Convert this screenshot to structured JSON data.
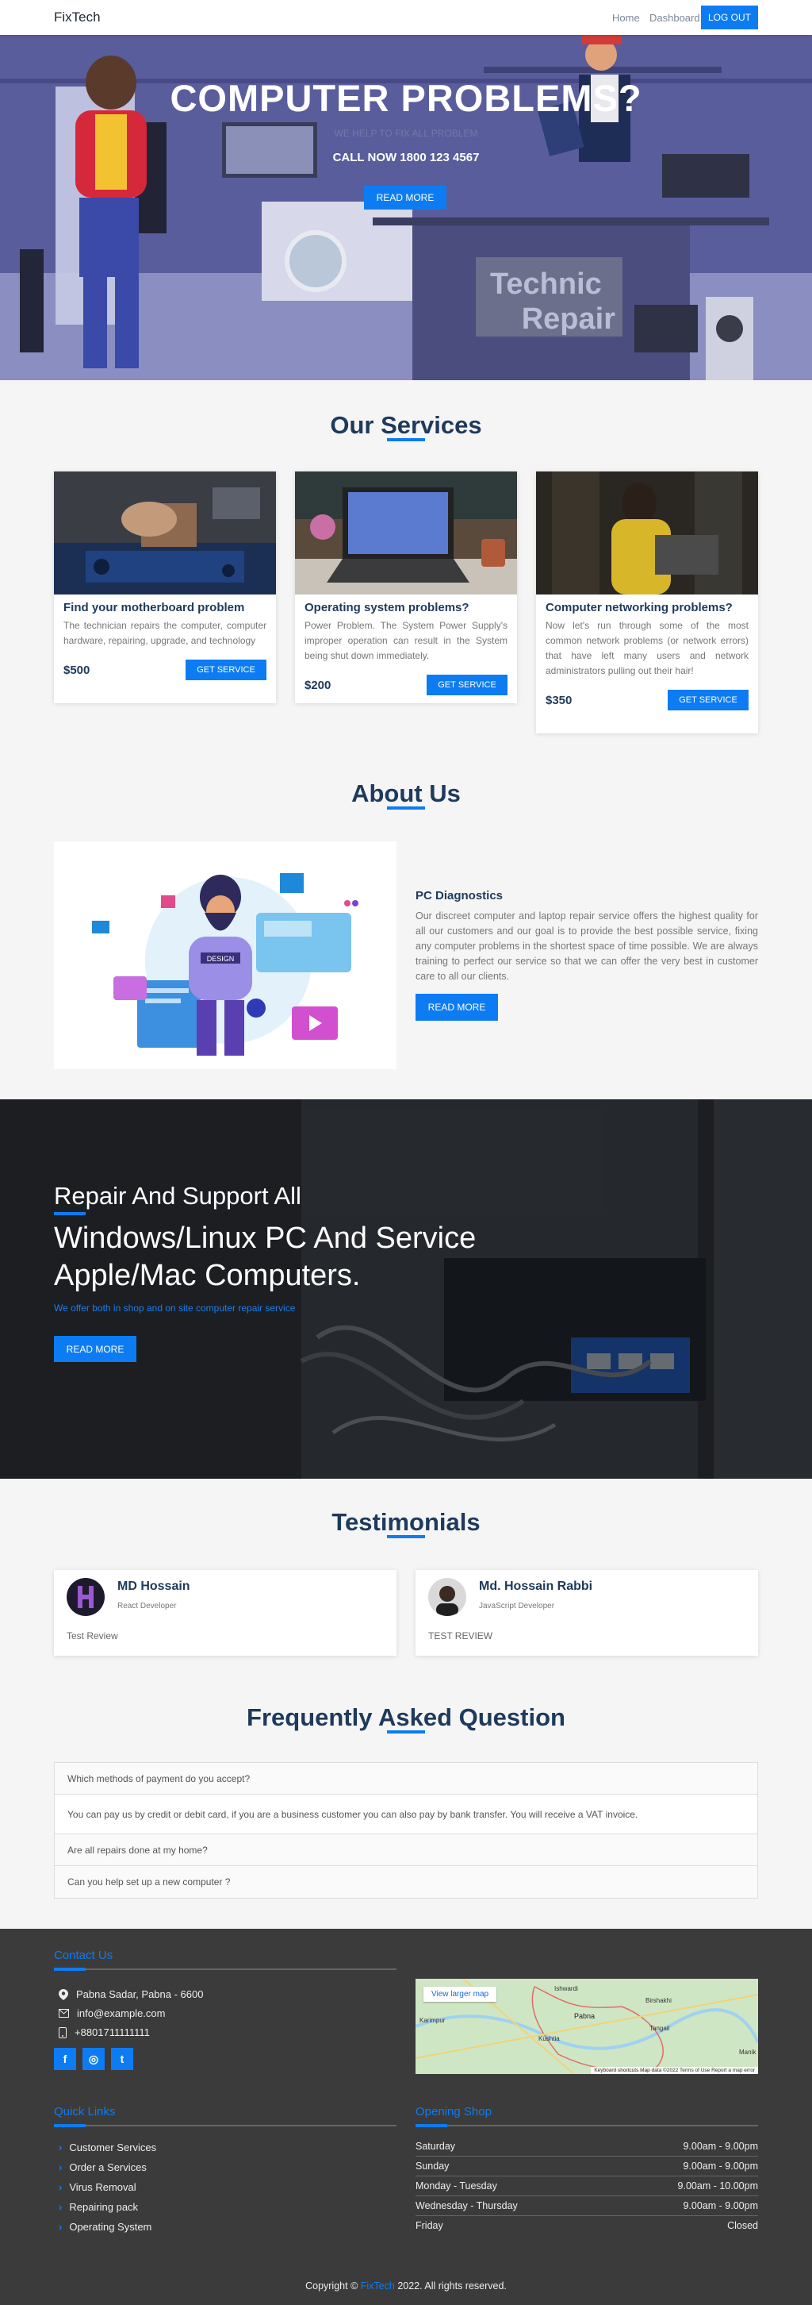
{
  "nav": {
    "brand": "FixTech",
    "home": "Home",
    "dashboard": "Dashboard",
    "logout": "LOG OUT"
  },
  "hero": {
    "title": "COMPUTER PROBLEMS?",
    "subtitle": "WE HELP TO FIX ALL PROBLEM",
    "call": "CALL NOW 1800 123 4567",
    "button": "READ MORE",
    "sign": [
      "Technic",
      "Repair"
    ]
  },
  "services": {
    "title": "Our Services",
    "cards": [
      {
        "title": "Find your motherboard problem",
        "text": "The technician repairs the computer, computer hardware, repairing, upgrade, and technology",
        "price": "$500",
        "button": "GET SERVICE"
      },
      {
        "title": "Operating system problems?",
        "text": "Power Problem. The System Power Supply's improper operation can result in the System being shut down immediately.",
        "price": "$200",
        "button": "GET SERVICE"
      },
      {
        "title": "Computer networking problems?",
        "text": "Now let's run through some of the most common network problems (or network errors) that have left many users and network administrators pulling out their hair!",
        "price": "$350",
        "button": "GET SERVICE"
      }
    ]
  },
  "about": {
    "title": "About Us",
    "heading": "PC Diagnostics",
    "text": "Our discreet computer and laptop repair service offers the highest quality for all our customers and our goal is to provide the best possible service, fixing any computer problems in the shortest space of time possible. We are always training to perfect our service so that we can offer the very best in customer care to all our clients.",
    "button": "READ MORE",
    "illustration_label": "DESIGN"
  },
  "banner": {
    "line1": "Repair And Support All",
    "line2": "Windows/Linux PC And Service",
    "line3": "Apple/Mac Computers.",
    "text": "We offer both in shop and on site computer repair service",
    "button": "READ MORE"
  },
  "testimonials": {
    "title": "Testimonials",
    "items": [
      {
        "name": "MD Hossain",
        "role": "React Developer",
        "review": "Test Review"
      },
      {
        "name": "Md. Hossain Rabbi",
        "role": "JavaScript Developer",
        "review": "TEST REVIEW"
      }
    ]
  },
  "faq": {
    "title": "Frequently Asked Question",
    "q1": "Which methods of payment do you accept?",
    "a1": "You can pay us by credit or debit card, if you are a business customer you can also pay by bank transfer. You will receive a VAT invoice.",
    "q2": "Are all repairs done at my home?",
    "q3": "Can you help set up a new computer ?"
  },
  "footer": {
    "contact_title": "Contact Us",
    "address": "Pabna Sadar, Pabna - 6600",
    "email": "info@example.com",
    "phone": "+8801711111111",
    "social": [
      "f",
      "◎",
      "t"
    ],
    "map_button": "View larger map",
    "map_attr": "Keyboard shortcuts   Map data ©2022   Terms of Use   Report a map error",
    "map_labels": [
      "Ishwardi",
      "Pabna",
      "Karimpur",
      "Kushtia",
      "Birshakhi",
      "Tangail",
      "Manik"
    ],
    "quick_title": "Quick Links",
    "links": [
      "Customer Services",
      "Order a Services",
      "Virus Removal",
      "Repairing pack",
      "Operating System"
    ],
    "hours_title": "Opening Shop",
    "hours": [
      {
        "day": "Saturday",
        "time": "9.00am - 9.00pm"
      },
      {
        "day": "Sunday",
        "time": "9.00am - 9.00pm"
      },
      {
        "day": "Monday - Tuesday",
        "time": "9.00am - 10.00pm"
      },
      {
        "day": "Wednesday - Thursday",
        "time": "9.00am - 9.00pm"
      },
      {
        "day": "Friday",
        "time": "Closed"
      }
    ],
    "copyright_pre": "Copyright ©",
    "copyright_brand": "FixTech",
    "copyright_post": "2022. All rights reserved."
  },
  "colors": {
    "accent": "#0d7cf2",
    "heading": "#1e3a5c",
    "footer_bg": "#3b3b3b"
  }
}
